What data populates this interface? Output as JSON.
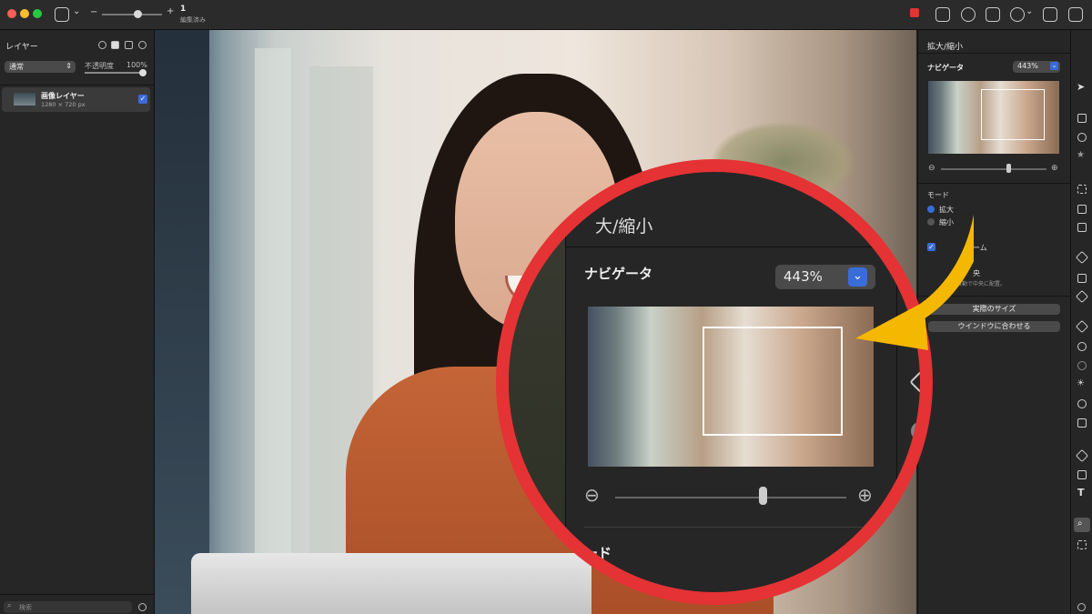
{
  "toolbar": {
    "minus": "−",
    "plus": "+",
    "edit_count": "1",
    "edit_label": "編集済み"
  },
  "left_panel": {
    "title": "レイヤー",
    "blend_mode": "通常",
    "opacity_label": "不透明度",
    "opacity_value": "100%",
    "layer_name": "画像レイヤー",
    "layer_size": "1280 × 720 px",
    "search_placeholder": "検索"
  },
  "right_panel": {
    "title": "拡大/縮小",
    "navigator_label": "ナビゲータ",
    "zoom_value": "443%",
    "mode_label": "モード",
    "mode_options": [
      "拡大",
      "縮小"
    ],
    "checkbox_label_partial": "ーム",
    "center_label_partial": "央",
    "center_desc_partial": "を自動で中央に配置。",
    "actual_size_button": "実際のサイズ",
    "fit_window_button": "ウインドウに合わせる"
  },
  "zoom_callout": {
    "title_partial": "大/縮小",
    "navigator_label": "ナビゲータ",
    "zoom_value": "443%",
    "mode_partial": "ード"
  },
  "colors": {
    "accent_red": "#e53234",
    "arrow_yellow": "#f5b800",
    "select_blue": "#3a6cd8"
  }
}
